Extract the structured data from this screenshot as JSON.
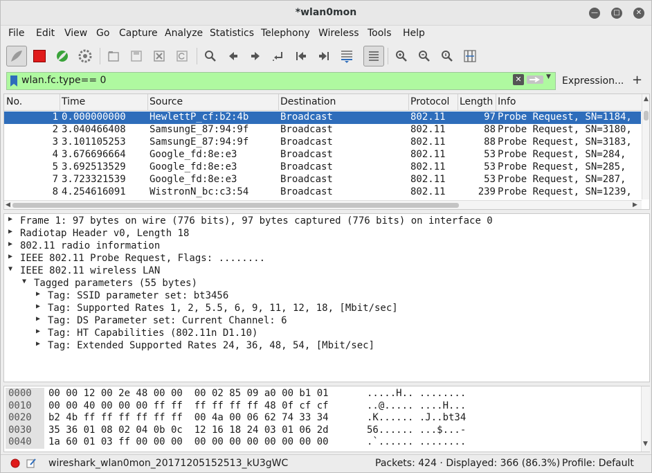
{
  "window": {
    "title": "*wlan0mon"
  },
  "menu": [
    "File",
    "Edit",
    "View",
    "Go",
    "Capture",
    "Analyze",
    "Statistics",
    "Telephony",
    "Wireless",
    "Tools",
    "Help"
  ],
  "filter": {
    "value": "wlan.fc.type== 0",
    "expression_label": "Expression...",
    "add_label": "+"
  },
  "columns": [
    "No.",
    "Time",
    "Source",
    "Destination",
    "Protocol",
    "Length",
    "Info"
  ],
  "packets": [
    {
      "no": "1",
      "time": "0.000000000",
      "source": "HewlettP_cf:b2:4b",
      "destination": "Broadcast",
      "protocol": "802.11",
      "length": "97",
      "info": "Probe Request, SN=1184,",
      "selected": true
    },
    {
      "no": "2",
      "time": "3.040466408",
      "source": "SamsungE_87:94:9f",
      "destination": "Broadcast",
      "protocol": "802.11",
      "length": "88",
      "info": "Probe Request, SN=3180,"
    },
    {
      "no": "3",
      "time": "3.101105253",
      "source": "SamsungE_87:94:9f",
      "destination": "Broadcast",
      "protocol": "802.11",
      "length": "88",
      "info": "Probe Request, SN=3183,"
    },
    {
      "no": "4",
      "time": "3.676696664",
      "source": "Google_fd:8e:e3",
      "destination": "Broadcast",
      "protocol": "802.11",
      "length": "53",
      "info": "Probe Request, SN=284, "
    },
    {
      "no": "5",
      "time": "3.692513529",
      "source": "Google_fd:8e:e3",
      "destination": "Broadcast",
      "protocol": "802.11",
      "length": "53",
      "info": "Probe Request, SN=285, "
    },
    {
      "no": "7",
      "time": "3.723321539",
      "source": "Google_fd:8e:e3",
      "destination": "Broadcast",
      "protocol": "802.11",
      "length": "53",
      "info": "Probe Request, SN=287, "
    },
    {
      "no": "8",
      "time": "4.254616091",
      "source": "WistronN_bc:c3:54",
      "destination": "Broadcast",
      "protocol": "802.11",
      "length": "239",
      "info": "Probe Request, SN=1239,"
    }
  ],
  "details": [
    {
      "text": "Frame 1: 97 bytes on wire (776 bits), 97 bytes captured (776 bits) on interface 0",
      "expanded": false,
      "level": 0
    },
    {
      "text": "Radiotap Header v0, Length 18",
      "expanded": false,
      "level": 0
    },
    {
      "text": "802.11 radio information",
      "expanded": false,
      "level": 0
    },
    {
      "text": "IEEE 802.11 Probe Request, Flags: ........",
      "expanded": false,
      "level": 0
    },
    {
      "text": "IEEE 802.11 wireless LAN",
      "expanded": true,
      "level": 0
    },
    {
      "text": "Tagged parameters (55 bytes)",
      "expanded": true,
      "level": 1
    },
    {
      "text": "Tag: SSID parameter set: bt3456",
      "expanded": false,
      "level": 2
    },
    {
      "text": "Tag: Supported Rates 1, 2, 5.5, 6, 9, 11, 12, 18, [Mbit/sec]",
      "expanded": false,
      "level": 2
    },
    {
      "text": "Tag: DS Parameter set: Current Channel: 6",
      "expanded": false,
      "level": 2
    },
    {
      "text": "Tag: HT Capabilities (802.11n D1.10)",
      "expanded": false,
      "level": 2
    },
    {
      "text": "Tag: Extended Supported Rates 24, 36, 48, 54, [Mbit/sec]",
      "expanded": false,
      "level": 2
    }
  ],
  "hex": [
    {
      "offset": "0000",
      "bytes": "00 00 12 00 2e 48 00 00  00 02 85 09 a0 00 b1 01",
      "ascii": ".....H.. ........"
    },
    {
      "offset": "0010",
      "bytes": "00 00 40 00 00 00 ff ff  ff ff ff ff 48 0f cf cf",
      "ascii": "..@..... ....H..."
    },
    {
      "offset": "0020",
      "bytes": "b2 4b ff ff ff ff ff ff  00 4a 00 06 62 74 33 34",
      "ascii": ".K...... .J..bt34"
    },
    {
      "offset": "0030",
      "bytes": "35 36 01 08 02 04 0b 0c  12 16 18 24 03 01 06 2d",
      "ascii": "56...... ...$...-"
    },
    {
      "offset": "0040",
      "bytes": "1a 60 01 03 ff 00 00 00  00 00 00 00 00 00 00 00",
      "ascii": ".`...... ........"
    }
  ],
  "status": {
    "file": "wireshark_wlan0mon_20171205152513_kU3gWC",
    "packets": "Packets: 424 · Displayed: 366 (86.3%)",
    "profile": "Profile: Default"
  },
  "colors": {
    "selected_row": "#2e6dbb",
    "filter_bg": "#aff9a0",
    "capture_stop": "#e01b1b"
  }
}
